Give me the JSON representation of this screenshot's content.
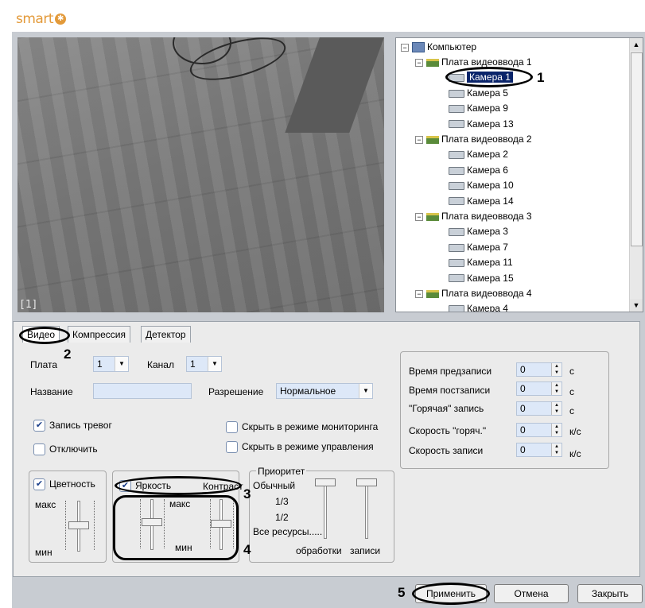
{
  "brand": {
    "logo_text": "smart",
    "logo_icon": "gear-icon"
  },
  "video": {
    "camera_overlay_label": "[1]"
  },
  "tree": {
    "root": "Компьютер",
    "boards": [
      {
        "label": "Плата видеоввода 1",
        "cameras": [
          "Камера 1",
          "Камера 5",
          "Камера 9",
          "Камера 13"
        ]
      },
      {
        "label": "Плата видеоввода 2",
        "cameras": [
          "Камера 2",
          "Камера 6",
          "Камера 10",
          "Камера 14"
        ]
      },
      {
        "label": "Плата видеоввода 3",
        "cameras": [
          "Камера 3",
          "Камера 7",
          "Камера 11",
          "Камера 15"
        ]
      },
      {
        "label": "Плата видеоввода 4",
        "cameras": [
          "Камера 4"
        ]
      }
    ],
    "selected": "Камера 1"
  },
  "tabs": [
    "Видео",
    "Компрессия",
    "Детектор"
  ],
  "settings": {
    "board_label": "Плата",
    "board_value": "1",
    "channel_label": "Канал",
    "channel_value": "1",
    "name_label": "Название",
    "name_value": "",
    "resolution_label": "Разрешение",
    "resolution_value": "Нормальное",
    "alarm_record_label": "Запись тревог",
    "alarm_record_checked": true,
    "disable_label": "Отключить",
    "disable_checked": false,
    "hide_monitoring_label": "Скрыть в режиме мониторинга",
    "hide_monitoring_checked": false,
    "hide_control_label": "Скрыть в режиме управления",
    "hide_control_checked": false
  },
  "recording": {
    "pre_record_label": "Время предзаписи",
    "pre_record_value": "0",
    "pre_record_unit": "с",
    "post_record_label": "Время постзаписи",
    "post_record_value": "0",
    "post_record_unit": "с",
    "hot_record_label": "\"Горячая\" запись",
    "hot_record_value": "0",
    "hot_record_unit": "с",
    "hot_speed_label": "Скорость \"горяч.\"",
    "hot_speed_value": "0",
    "hot_speed_unit": "к/с",
    "record_speed_label": "Скорость записи",
    "record_speed_value": "0",
    "record_speed_unit": "к/с"
  },
  "image": {
    "color_label": "Цветность",
    "color_checked": true,
    "brightness_label": "Яркость",
    "brightness_checked": true,
    "contrast_label": "Контраст",
    "max_label": "макс",
    "min_label": "мин"
  },
  "priority": {
    "title": "Приоритет",
    "levels": [
      "Обычный",
      "1/3",
      "1/2",
      "Все ресурсы....."
    ],
    "processing_label": "обработки",
    "record_label": "записи"
  },
  "buttons": {
    "apply": "Применить",
    "cancel": "Отмена",
    "close": "Закрыть"
  },
  "callouts": [
    "1",
    "2",
    "3",
    "4",
    "5"
  ]
}
